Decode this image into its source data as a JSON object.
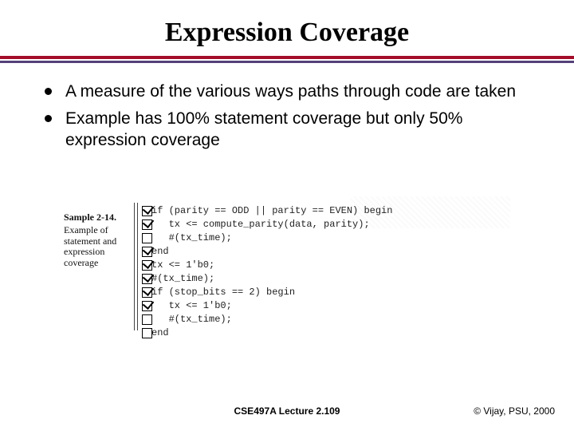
{
  "title": "Expression Coverage",
  "bullets": [
    "A measure of the various ways paths through code are taken",
    "Example has 100% statement coverage but only 50% expression coverage"
  ],
  "figure": {
    "caption_bold": "Sample 2-14.",
    "caption_rest": "Example of statement and expression coverage",
    "checkboxes": [
      true,
      true,
      false,
      true,
      true,
      true,
      true,
      true,
      false,
      false
    ],
    "code_lines": [
      "if (parity == ODD || parity == EVEN) begin",
      "   tx <= compute_parity(data, parity);",
      "   #(tx_time);",
      "end",
      "tx <= 1'b0;",
      "#(tx_time);",
      "if (stop_bits == 2) begin",
      "   tx <= 1'b0;",
      "   #(tx_time);",
      "end"
    ]
  },
  "footer_center": "CSE497A Lecture 2.109",
  "footer_right": "© Vijay, PSU, 2000"
}
